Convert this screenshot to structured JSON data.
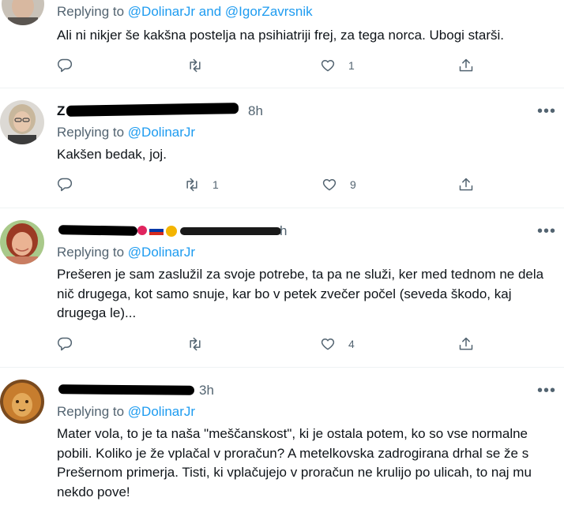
{
  "tweets": [
    {
      "name": "",
      "handle": "",
      "time": "",
      "replying_prefix": "Replying to",
      "replying_to": "@DolinarJr and @IgorZavrsnik",
      "text": "Ali ni nikjer še kakšna postelja na psihiatriji frej, za tega norca. Ubogi starši.",
      "reply_count": "",
      "retweet_count": "",
      "like_count": "1"
    },
    {
      "name": "Z",
      "handle": "",
      "time": "8h",
      "replying_prefix": "Replying to",
      "replying_to": "@DolinarJr",
      "text": "Kakšen bedak, joj.",
      "reply_count": "",
      "retweet_count": "1",
      "like_count": "9"
    },
    {
      "name": "",
      "handle": "",
      "time": "h",
      "replying_prefix": "Replying to",
      "replying_to": "@DolinarJr",
      "text": "Prešeren je sam zaslužil za svoje potrebe, ta pa ne služi, ker med tednom ne dela nič drugega, kot samo snuje, kar bo v petek zvečer počel (seveda škodo, kaj drugega le)...",
      "reply_count": "",
      "retweet_count": "",
      "like_count": "4"
    },
    {
      "name": "",
      "handle": "",
      "time": "3h",
      "replying_prefix": "Replying to",
      "replying_to": "@DolinarJr",
      "text": "Mater vola, to je ta naša \"meščanskost\", ki je ostala potem, ko so vse normalne pobili. Koliko je že vplačal v proračun? A metelkovska zadrogirana drhal se že s Prešernom primerja. Tisti, ki vplačujejo v proračun ne krulijo po ulicah, to naj mu nekdo pove!",
      "reply_count": "",
      "retweet_count": "",
      "like_count": ""
    }
  ],
  "icons": {
    "reply": "reply-icon",
    "retweet": "retweet-icon",
    "like": "like-icon",
    "share": "share-icon",
    "more": "more-icon"
  },
  "colors": {
    "accent": "#1d9bf0",
    "secondary_text": "#536471",
    "primary_text": "#0f1419",
    "divider": "#eff3f4"
  }
}
